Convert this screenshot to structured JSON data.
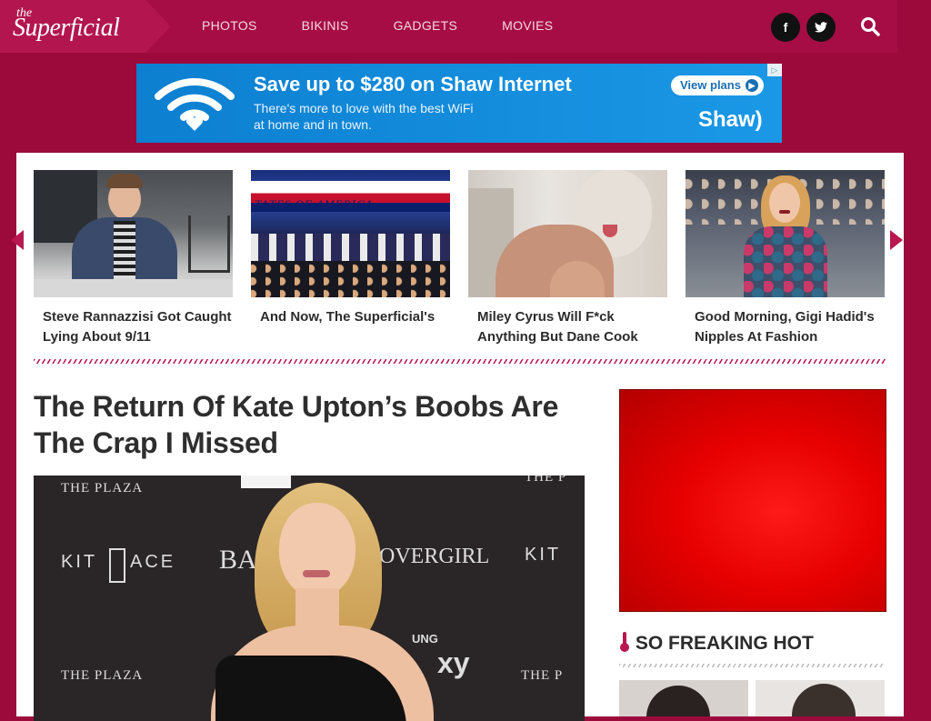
{
  "brand": {
    "logo_small": "the",
    "logo_main": "Superficial"
  },
  "nav": {
    "items": [
      "PHOTOS",
      "BIKINIS",
      "GADGETS",
      "MOVIES"
    ]
  },
  "social": {
    "facebook_icon": "facebook-icon",
    "twitter_icon": "twitter-icon",
    "search_icon": "search-icon"
  },
  "ad": {
    "headline": "Save up to $280 on Shaw Internet",
    "subline": "There's more to love with the best WiFi at home and in town.",
    "cta": "View plans",
    "brand": "Shaw)",
    "adchoice": "▷",
    "color": "#1a8fdc"
  },
  "carousel": {
    "items": [
      {
        "title": "Steve Rannazzisi Got Caught Lying About 9/11"
      },
      {
        "title": "And Now, The Superficial's",
        "sign": "TATES OF AMERICA"
      },
      {
        "title": "Miley Cyrus Will F*ck Anything But Dane Cook"
      },
      {
        "title": "Good Morning, Gigi Hadid's Nipples At Fashion"
      }
    ]
  },
  "article": {
    "title": "The Return Of Kate Upton’s Boobs Are The Crap I Missed",
    "wall": [
      "THE PLAZA",
      "KIT",
      "ACE",
      "BAZ",
      "COVERGIRL",
      "KIT",
      "THE PLAZA",
      "UNG",
      "xy",
      "THE P",
      "THE P"
    ]
  },
  "sidebar": {
    "hot_title": "SO FREAKING HOT"
  },
  "colors": {
    "brand": "#a60d44",
    "page": "#9c0a3c",
    "accent": "#b8174f"
  }
}
